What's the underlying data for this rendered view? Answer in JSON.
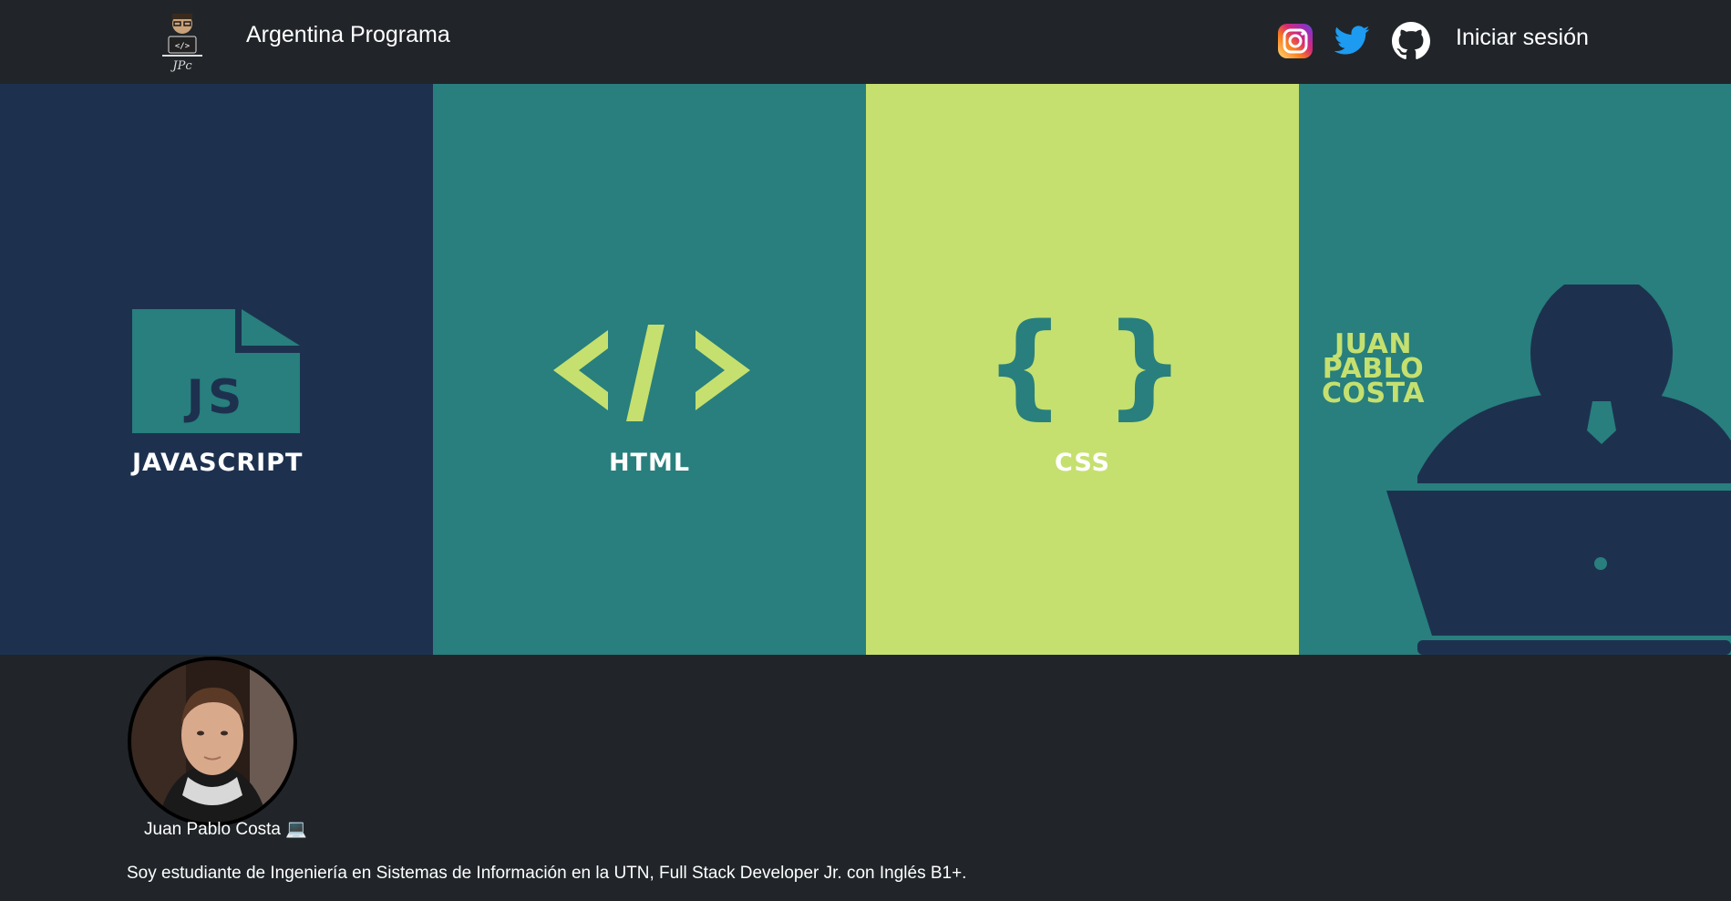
{
  "navbar": {
    "logo_text": "JPc",
    "brand": "Argentina Programa",
    "social": {
      "instagram": "instagram-icon",
      "twitter": "twitter-icon",
      "github": "github-icon"
    },
    "login": "Iniciar sesión"
  },
  "banner": {
    "panels": [
      {
        "icon_text": "JS",
        "label": "JAVASCRIPT"
      },
      {
        "icon_text": "</>",
        "label": "HTML"
      },
      {
        "icon_text": "{ }",
        "label": "CSS"
      }
    ],
    "name_lines": [
      "JUAN",
      "PABLO",
      "COSTA"
    ]
  },
  "profile": {
    "name": "Juan Pablo Costa 💻",
    "bio": "Soy estudiante de Ingeniería en Sistemas de Información en la UTN, Full Stack Developer Jr. con Inglés B1+."
  },
  "colors": {
    "navy": "#1d314f",
    "teal": "#287f7d",
    "lime": "#c5e06f",
    "dark": "#212529"
  }
}
